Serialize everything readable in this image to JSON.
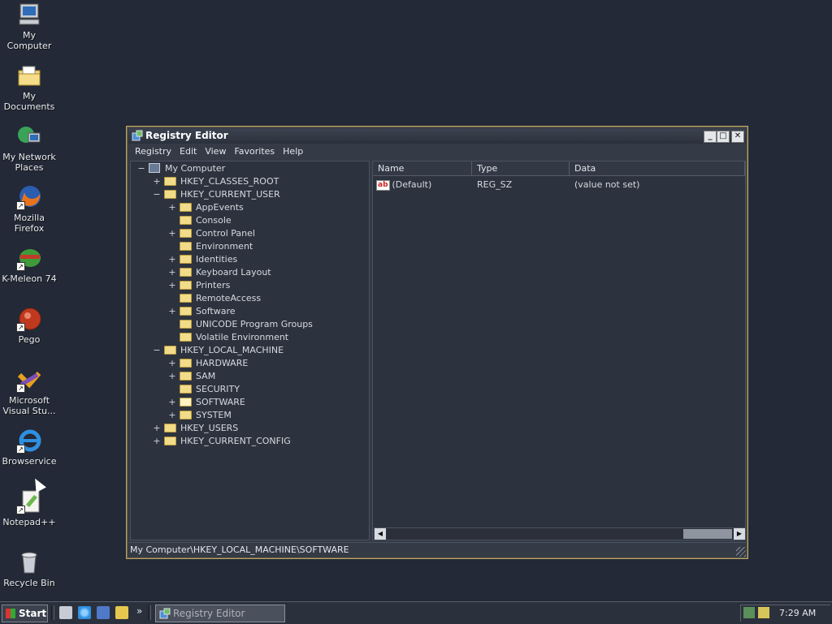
{
  "desktop": {
    "icons": [
      {
        "label": "My Computer",
        "icon": "computer-icon"
      },
      {
        "label": "My Documents",
        "icon": "documents-folder-icon"
      },
      {
        "label": "My Network Places",
        "icon": "network-places-icon"
      },
      {
        "label": "Mozilla Firefox",
        "icon": "firefox-icon"
      },
      {
        "label": "K-Meleon 74",
        "icon": "kmeleon-icon"
      },
      {
        "label": "Pego",
        "icon": "pego-icon"
      },
      {
        "label": "Microsoft Visual Stu...",
        "icon": "visual-studio-icon"
      },
      {
        "label": "Browservice",
        "icon": "internet-explorer-icon"
      },
      {
        "label": "Notepad++",
        "icon": "notepadpp-icon"
      },
      {
        "label": "Recycle Bin",
        "icon": "recycle-bin-icon"
      }
    ]
  },
  "window": {
    "title": "Registry Editor",
    "controls": {
      "minimize": "_",
      "maximize": "□",
      "close": "✕"
    },
    "menu": [
      "Registry",
      "Edit",
      "View",
      "Favorites",
      "Help"
    ],
    "tree": [
      {
        "label": "My Computer",
        "expander": "−",
        "level": 0,
        "kind": "computer"
      },
      {
        "label": "HKEY_CLASSES_ROOT",
        "expander": "+",
        "level": 1
      },
      {
        "label": "HKEY_CURRENT_USER",
        "expander": "−",
        "level": 1
      },
      {
        "label": "AppEvents",
        "expander": "+",
        "level": 2
      },
      {
        "label": "Console",
        "expander": "",
        "level": 2
      },
      {
        "label": "Control Panel",
        "expander": "+",
        "level": 2
      },
      {
        "label": "Environment",
        "expander": "",
        "level": 2
      },
      {
        "label": "Identities",
        "expander": "+",
        "level": 2
      },
      {
        "label": "Keyboard Layout",
        "expander": "+",
        "level": 2
      },
      {
        "label": "Printers",
        "expander": "+",
        "level": 2
      },
      {
        "label": "RemoteAccess",
        "expander": "",
        "level": 2
      },
      {
        "label": "Software",
        "expander": "+",
        "level": 2
      },
      {
        "label": "UNICODE Program Groups",
        "expander": "",
        "level": 2
      },
      {
        "label": "Volatile Environment",
        "expander": "",
        "level": 2
      },
      {
        "label": "HKEY_LOCAL_MACHINE",
        "expander": "−",
        "level": 1
      },
      {
        "label": "HARDWARE",
        "expander": "+",
        "level": 2
      },
      {
        "label": "SAM",
        "expander": "+",
        "level": 2
      },
      {
        "label": "SECURITY",
        "expander": "",
        "level": 2
      },
      {
        "label": "SOFTWARE",
        "expander": "+",
        "level": 2,
        "open": true
      },
      {
        "label": "SYSTEM",
        "expander": "+",
        "level": 2
      },
      {
        "label": "HKEY_USERS",
        "expander": "+",
        "level": 1
      },
      {
        "label": "HKEY_CURRENT_CONFIG",
        "expander": "+",
        "level": 1
      }
    ],
    "list": {
      "columns": [
        "Name",
        "Type",
        "Data"
      ],
      "rows": [
        {
          "name": "(Default)",
          "type": "REG_SZ",
          "data": "(value not set)",
          "icon": "ab"
        }
      ]
    },
    "status": "My Computer\\HKEY_LOCAL_MACHINE\\SOFTWARE"
  },
  "taskbar": {
    "start_label": "Start",
    "chevron": "»",
    "task_label": "Registry Editor",
    "clock": "7:29 AM"
  },
  "colors": {
    "desktop": "#232936",
    "window_border": "#b9a66a",
    "folder": "#f1dc8a"
  }
}
